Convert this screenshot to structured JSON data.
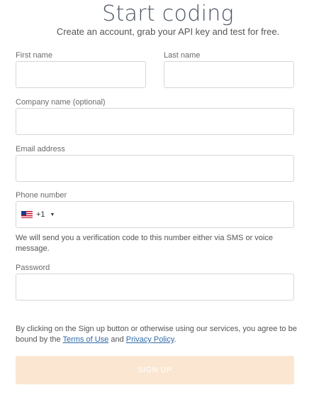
{
  "header": {
    "title": "Start coding",
    "subtitle": "Create an account, grab your API key and test for free."
  },
  "form": {
    "first_name": {
      "label": "First name",
      "value": ""
    },
    "last_name": {
      "label": "Last name",
      "value": ""
    },
    "company": {
      "label": "Company name (optional)",
      "value": ""
    },
    "email": {
      "label": "Email address",
      "value": ""
    },
    "phone": {
      "label": "Phone number",
      "country_icon": "us-flag-icon",
      "dial_code": "+1",
      "value": "",
      "help": "We will send you a verification code to this number either via SMS or voice message."
    },
    "password": {
      "label": "Password",
      "value": ""
    }
  },
  "legal": {
    "prefix": "By clicking on the Sign up button or otherwise using our services, you agree to be bound by the ",
    "terms_link": "Terms of Use",
    "middle": " and ",
    "privacy_link": "Privacy Policy",
    "suffix": "."
  },
  "actions": {
    "signup_label": "SIGN UP"
  },
  "colors": {
    "signup_bg": "#fbe7d1",
    "link": "#2f6aa8",
    "border": "#d6d6d6"
  }
}
